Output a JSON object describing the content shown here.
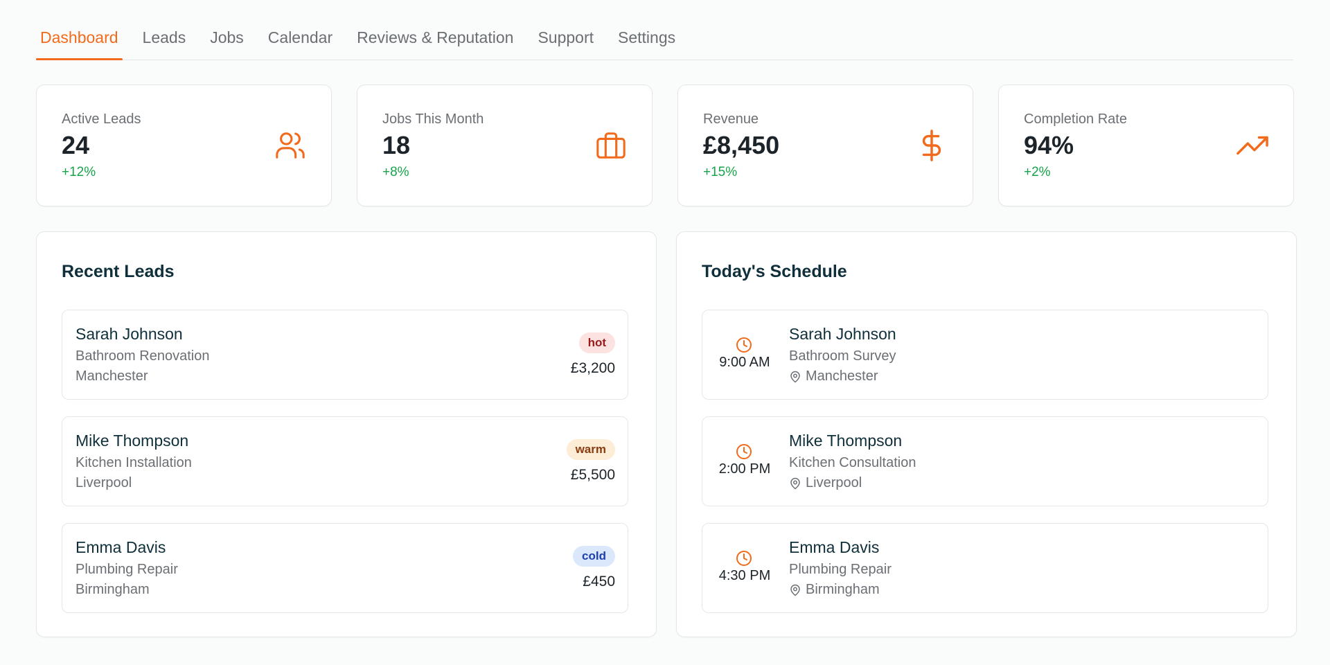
{
  "tabs": [
    {
      "label": "Dashboard",
      "active": true
    },
    {
      "label": "Leads"
    },
    {
      "label": "Jobs"
    },
    {
      "label": "Calendar"
    },
    {
      "label": "Reviews & Reputation"
    },
    {
      "label": "Support"
    },
    {
      "label": "Settings"
    }
  ],
  "stats": [
    {
      "label": "Active Leads",
      "value": "24",
      "change": "+12%",
      "icon": "users-icon"
    },
    {
      "label": "Jobs This Month",
      "value": "18",
      "change": "+8%",
      "icon": "briefcase-icon"
    },
    {
      "label": "Revenue",
      "value": "£8,450",
      "change": "+15%",
      "icon": "dollar-icon"
    },
    {
      "label": "Completion Rate",
      "value": "94%",
      "change": "+2%",
      "icon": "trending-up-icon"
    }
  ],
  "recent_leads": {
    "title": "Recent Leads",
    "items": [
      {
        "name": "Sarah Johnson",
        "service": "Bathroom Renovation",
        "location": "Manchester",
        "status": "hot",
        "amount": "£3,200"
      },
      {
        "name": "Mike Thompson",
        "service": "Kitchen Installation",
        "location": "Liverpool",
        "status": "warm",
        "amount": "£5,500"
      },
      {
        "name": "Emma Davis",
        "service": "Plumbing Repair",
        "location": "Birmingham",
        "status": "cold",
        "amount": "£450"
      }
    ]
  },
  "schedule": {
    "title": "Today's Schedule",
    "items": [
      {
        "time": "9:00 AM",
        "name": "Sarah Johnson",
        "service": "Bathroom Survey",
        "location": "Manchester"
      },
      {
        "time": "2:00 PM",
        "name": "Mike Thompson",
        "service": "Kitchen Consultation",
        "location": "Liverpool"
      },
      {
        "time": "4:30 PM",
        "name": "Emma Davis",
        "service": "Plumbing Repair",
        "location": "Birmingham"
      }
    ]
  },
  "colors": {
    "accent": "#f26a1b",
    "positive": "#16a34a",
    "heading": "#0f2f3a"
  }
}
